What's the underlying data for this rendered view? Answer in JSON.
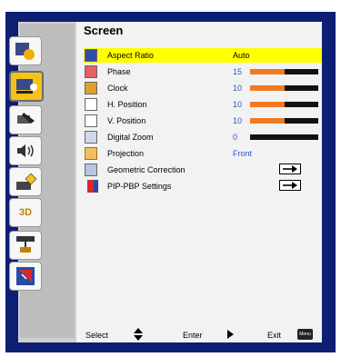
{
  "menu": {
    "title": "Screen",
    "items": [
      {
        "label": "Aspect Ratio",
        "value": "Auto",
        "selected": true,
        "icon": "aspect-ratio-icon"
      },
      {
        "label": "Phase",
        "value": "15",
        "level": 0.5,
        "icon": "phase-icon"
      },
      {
        "label": "Clock",
        "value": "10",
        "level": 0.5,
        "icon": "clock-icon"
      },
      {
        "label": "H. Position",
        "value": "10",
        "level": 0.5,
        "icon": "h-position-icon"
      },
      {
        "label": "V. Position",
        "value": "10",
        "level": 0.5,
        "icon": "v-position-icon"
      },
      {
        "label": "Digital Zoom",
        "value": "0",
        "level": 0,
        "icon": "digital-zoom-icon"
      },
      {
        "label": "Projection",
        "value": "Front",
        "icon": "projection-icon"
      },
      {
        "label": "Geometric Correction",
        "value": "",
        "icon": "geometric-correction-icon"
      },
      {
        "label": "PIP-PBP Settings",
        "value": "",
        "icon": "pip-pbp-icon"
      }
    ]
  },
  "sidebar": [
    "picture-icon",
    "screen-icon",
    "setting-icon",
    "volume-icon",
    "options-icon",
    "3d-icon",
    "network-icon",
    "information-icon"
  ],
  "sidebar_3d_text": "3D",
  "footer": {
    "select": "Select",
    "enter": "Enter",
    "exit": "Exit",
    "menu_key": "Menu"
  },
  "colors": {
    "frame": "#0c1f73",
    "highlight": "#ffff00",
    "active_tab": "#f4c21a",
    "bar_fill": "#f07a21",
    "value_text": "#2a55c8"
  }
}
